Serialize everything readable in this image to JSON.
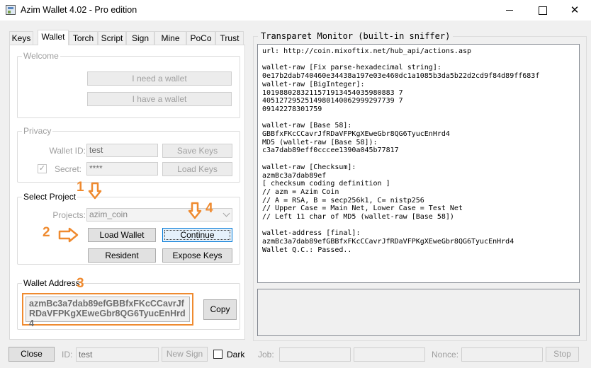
{
  "window": {
    "title": "Azim Wallet 4.02 - Pro edition",
    "close_glyph": "✕"
  },
  "tabs": [
    {
      "label": "Keys"
    },
    {
      "label": "Wallet"
    },
    {
      "label": "Torch"
    },
    {
      "label": "Script"
    },
    {
      "label": "Sign"
    },
    {
      "label": "Mine"
    },
    {
      "label": "PoCo"
    },
    {
      "label": "Trust"
    }
  ],
  "welcome": {
    "title": "Welcome",
    "need_wallet": "I need a wallet",
    "have_wallet": "I have a wallet"
  },
  "privacy": {
    "title": "Privacy",
    "wallet_id_label": "Wallet ID:",
    "wallet_id_value": "test",
    "save_keys": "Save Keys",
    "secret_label": "Secret:",
    "secret_value": "****",
    "secret_checked_glyph": "✓",
    "load_keys": "Load Keys"
  },
  "select_project": {
    "title": "Select Project",
    "projects_label": "Projects:",
    "projects_value": "azim_coin",
    "load_wallet": "Load Wallet",
    "continue": "Continue",
    "resident": "Resident",
    "expose_keys": "Expose Keys"
  },
  "wallet_address": {
    "title": "Wallet Address",
    "value": "azmBc3a7dab89efGBBfxFKcCCavrJfRDaVFPKgXEweGbr8QG6TyucEnHrd4",
    "copy": "Copy"
  },
  "annotations": {
    "one": "1",
    "two": "2",
    "three": "3",
    "four": "4"
  },
  "monitor": {
    "title": "Transparet Monitor (built-in sniffer)",
    "log": "url: http://coin.mixoftix.net/hub_api/actions.asp\n\nwallet-raw [Fix parse-hexadecimal string]:\n0e17b2dab740460e34438a197e03e460dc1a1085b3da5b22d2cd9f84d89ff683f\nwallet-raw [BigInteger]:\n1019880283211571913454035980883 7\n4051272952514980140062999297739 7\n09142278301759\n\nwallet-raw [Base 58]:\nGBBfxFKcCCavrJfRDaVFPKgXEweGbr8QG6TyucEnHrd4\nMD5 (wallet-raw [Base 58]):\nc3a7dab89eff0cccee1390a045b77817\n\nwallet-raw [Checksum]:\nazmBc3a7dab89ef\n[ checksum coding definition ]\n// azm = Azim Coin\n// A = RSA, B = secp256k1, C= nistp256\n// Upper Case = Main Net, Lower Case = Test Net\n// Left 11 char of MD5 (wallet-raw [Base 58])\n\nwallet-address [final]:\nazmBc3a7dab89efGBBfxFKcCCavrJfRDaVFPKgXEweGbr8QG6TyucEnHrd4\nWallet Q.C.: Passed.."
  },
  "bottom": {
    "close": "Close",
    "id_label": "ID:",
    "id_value": "test",
    "new_sign": "New Sign",
    "dark_label": "Dark",
    "job_label": "Job:",
    "job_value": "",
    "field2_value": "",
    "nonce_label": "Nonce:",
    "nonce_value": "",
    "stop": "Stop"
  },
  "colors": {
    "annotation": "#ef8a2f",
    "focus": "#0078d7"
  }
}
